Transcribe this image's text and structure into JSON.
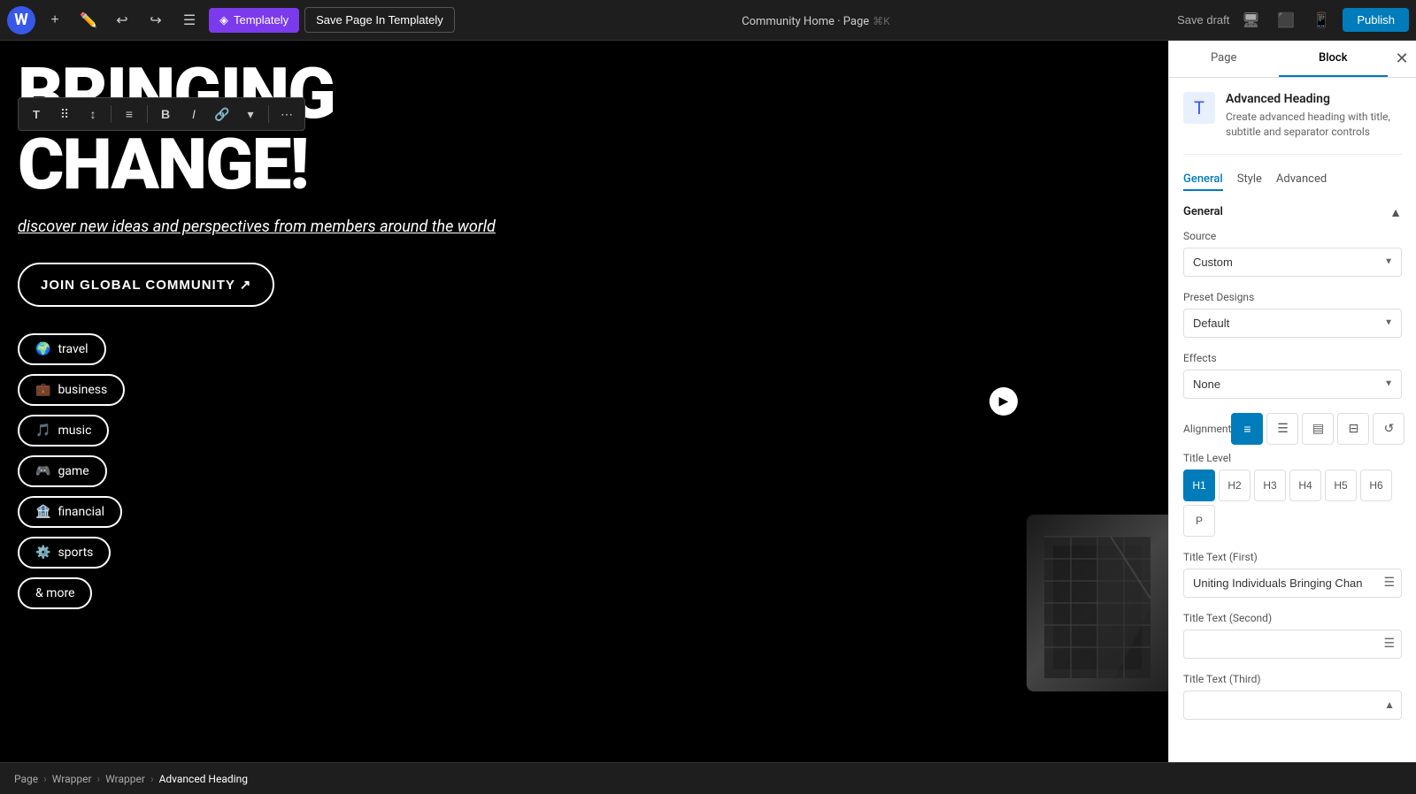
{
  "topbar": {
    "wp_logo": "W",
    "add_label": "+",
    "templately_label": "Templately",
    "save_templately_label": "Save Page In Templately",
    "page_title": "Community Home · Page",
    "kbd_hint": "⌘K",
    "save_draft_label": "Save draft",
    "publish_label": "Publish"
  },
  "floating_toolbar": {
    "transform_icon": "T",
    "drag_icon": "⠿",
    "move_up_down": "↕",
    "align_icon": "≡",
    "bold_icon": "B",
    "italic_icon": "I",
    "link_icon": "🔗",
    "dropdown_icon": "▾",
    "more_icon": "⋯"
  },
  "canvas": {
    "heading_line1": "BRINGING",
    "heading_line2": "CHANGE!",
    "subtitle": "discover new ideas and perspectives from members around the world",
    "join_btn_label": "JOIN GLOBAL COMMUNITY ↗",
    "tags": [
      {
        "emoji": "🌍",
        "label": "travel"
      },
      {
        "emoji": "💼",
        "label": "business"
      },
      {
        "emoji": "🎵",
        "label": "music"
      },
      {
        "emoji": "🎮",
        "label": "game"
      },
      {
        "emoji": "🏦",
        "label": "financial"
      },
      {
        "emoji": "⚙️",
        "label": "sports"
      },
      {
        "emoji": "",
        "label": "& more"
      }
    ]
  },
  "sidebar": {
    "tabs": [
      "Page",
      "Block"
    ],
    "active_tab": "Block",
    "block_name": "Advanced Heading",
    "block_desc": "Create advanced heading with title, subtitle and separator controls",
    "panel_tabs": [
      "General",
      "Style",
      "Advanced"
    ],
    "active_panel_tab": "General",
    "section_title": "General",
    "source_label": "Source",
    "source_options": [
      "Custom"
    ],
    "source_selected": "Custom",
    "preset_label": "Preset Designs",
    "preset_options": [
      "Default"
    ],
    "preset_selected": "Default",
    "effects_label": "Effects",
    "effects_options": [
      "None"
    ],
    "effects_selected": "None",
    "alignment_label": "Alignment",
    "alignment_options": [
      "left",
      "center",
      "right",
      "justify",
      "reset"
    ],
    "active_alignment": "left",
    "title_level_label": "Title Level",
    "title_levels": [
      "H1",
      "H2",
      "H3",
      "H4",
      "H5",
      "H6",
      "P"
    ],
    "active_level": "H1",
    "title_text_first_label": "Title Text (First)",
    "title_text_first_value": "Uniting Individuals Bringing Chan",
    "title_text_second_label": "Title Text (Second)",
    "title_text_second_value": "",
    "title_text_third_label": "Title Text (Third)",
    "title_text_third_value": ""
  },
  "breadcrumb": {
    "items": [
      "Page",
      "Wrapper",
      "Wrapper",
      "Advanced Heading"
    ]
  }
}
